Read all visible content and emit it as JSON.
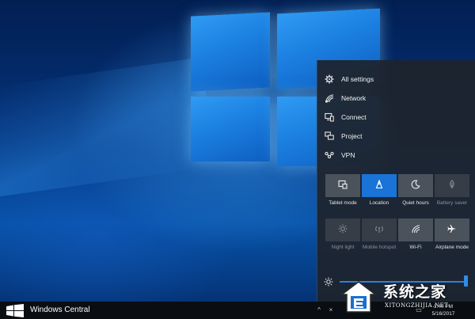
{
  "action_center": {
    "links": [
      {
        "label": "All settings",
        "icon": "gear-icon"
      },
      {
        "label": "Network",
        "icon": "network-icon"
      },
      {
        "label": "Connect",
        "icon": "connect-icon"
      },
      {
        "label": "Project",
        "icon": "project-icon"
      },
      {
        "label": "VPN",
        "icon": "vpn-icon"
      }
    ],
    "quick_actions": [
      {
        "label": "Tablet mode",
        "icon": "tablet-mode-icon",
        "state": "off"
      },
      {
        "label": "Location",
        "icon": "location-icon",
        "state": "on"
      },
      {
        "label": "Quiet hours",
        "icon": "moon-icon",
        "state": "off"
      },
      {
        "label": "Battery saver",
        "icon": "battery-saver-icon",
        "state": "disabled"
      },
      {
        "label": "Night light",
        "icon": "sun-icon",
        "state": "disabled"
      },
      {
        "label": "Mobile hotspot",
        "icon": "hotspot-icon",
        "state": "disabled"
      },
      {
        "label": "Wi-Fi",
        "icon": "wifi-icon",
        "state": "off"
      },
      {
        "label": "Airplane mode",
        "icon": "airplane-icon",
        "state": "off"
      }
    ],
    "brightness": {
      "icon": "brightness-icon",
      "level": 1.0
    }
  },
  "taskbar": {
    "brand_label": "Windows Central",
    "clock_time": "1:49 PM",
    "clock_date": "5/16/2017"
  },
  "watermark": {
    "site_name_cn": "系统之家",
    "url": "XITONGZHIJIA.NET"
  },
  "colors": {
    "accent": "#1a73d6",
    "panel": "#1e242c",
    "tile": "#4a525c",
    "taskbar": "#0a0d12"
  }
}
